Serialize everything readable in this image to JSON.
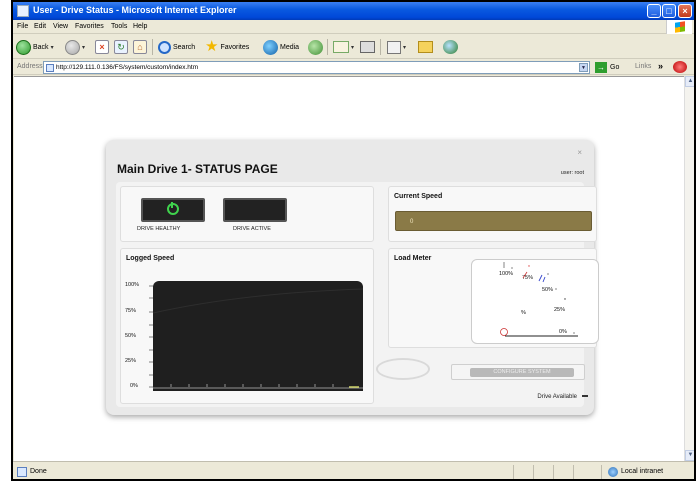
{
  "window": {
    "title": "User - Drive Status - Microsoft Internet Explorer"
  },
  "menu": [
    "File",
    "Edit",
    "View",
    "Favorites",
    "Tools",
    "Help"
  ],
  "toolbar": {
    "back": "Back",
    "search": "Search",
    "favorites": "Favorites",
    "media": "Media"
  },
  "address": {
    "label": "Address",
    "url": "http://129.111.0.136/FS/system/custom/index.htm",
    "go": "Go",
    "links": "Links"
  },
  "status": {
    "text": "Done",
    "zone": "Local intranet"
  },
  "app": {
    "title": "Main Drive 1- STATUS PAGE",
    "user": "user: root",
    "close": "×",
    "indicators": {
      "healthy": "DRIVE HEALTHY",
      "active": "DRIVE ACTIVE"
    },
    "current_speed": {
      "title": "Current Speed",
      "value": "0"
    },
    "logged_speed": {
      "title": "Logged Speed",
      "ticks": [
        "100%",
        "75%",
        "50%",
        "25%",
        "0%"
      ]
    },
    "load_meter": {
      "title": "Load Meter",
      "labels": {
        "l100": "100%",
        "l75": "75%",
        "l50": "50%",
        "l25": "25%",
        "l0": "0%",
        "unit": "%"
      }
    },
    "configure": "CONFIGURE SYSTEM",
    "availability": "Drive Available"
  }
}
